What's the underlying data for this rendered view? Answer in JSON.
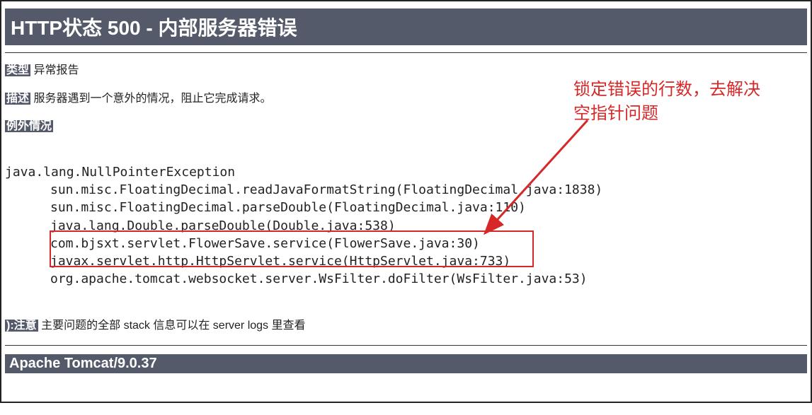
{
  "header": {
    "title": "HTTP状态 500 - 内部服务器错误"
  },
  "type_row": {
    "label": "类型",
    "value": "异常报告"
  },
  "desc_row": {
    "label": "描述",
    "value": "服务器遇到一个意外的情况，阻止它完成请求。"
  },
  "exception_row": {
    "label": "例外情况"
  },
  "stack": {
    "line0": "java.lang.NullPointerException",
    "line1": "sun.misc.FloatingDecimal.readJavaFormatString(FloatingDecimal.java:1838)",
    "line2": "sun.misc.FloatingDecimal.parseDouble(FloatingDecimal.java:110)",
    "line3": "java.lang.Double.parseDouble(Double.java:538)",
    "line4": "com.bjsxt.servlet.FlowerSave.service(FlowerSave.java:30)",
    "line5": "javax.servlet.http.HttpServlet.service(HttpServlet.java:733)",
    "line6": "org.apache.tomcat.websocket.server.WsFilter.doFilter(WsFilter.java:53)"
  },
  "note_row": {
    "label": "):注意",
    "value": "主要问题的全部 stack 信息可以在 server logs 里查看"
  },
  "footer": {
    "text": "Apache Tomcat/9.0.37"
  },
  "annotation": {
    "line1": "锁定错误的行数，去解决",
    "line2": "空指针问题"
  }
}
